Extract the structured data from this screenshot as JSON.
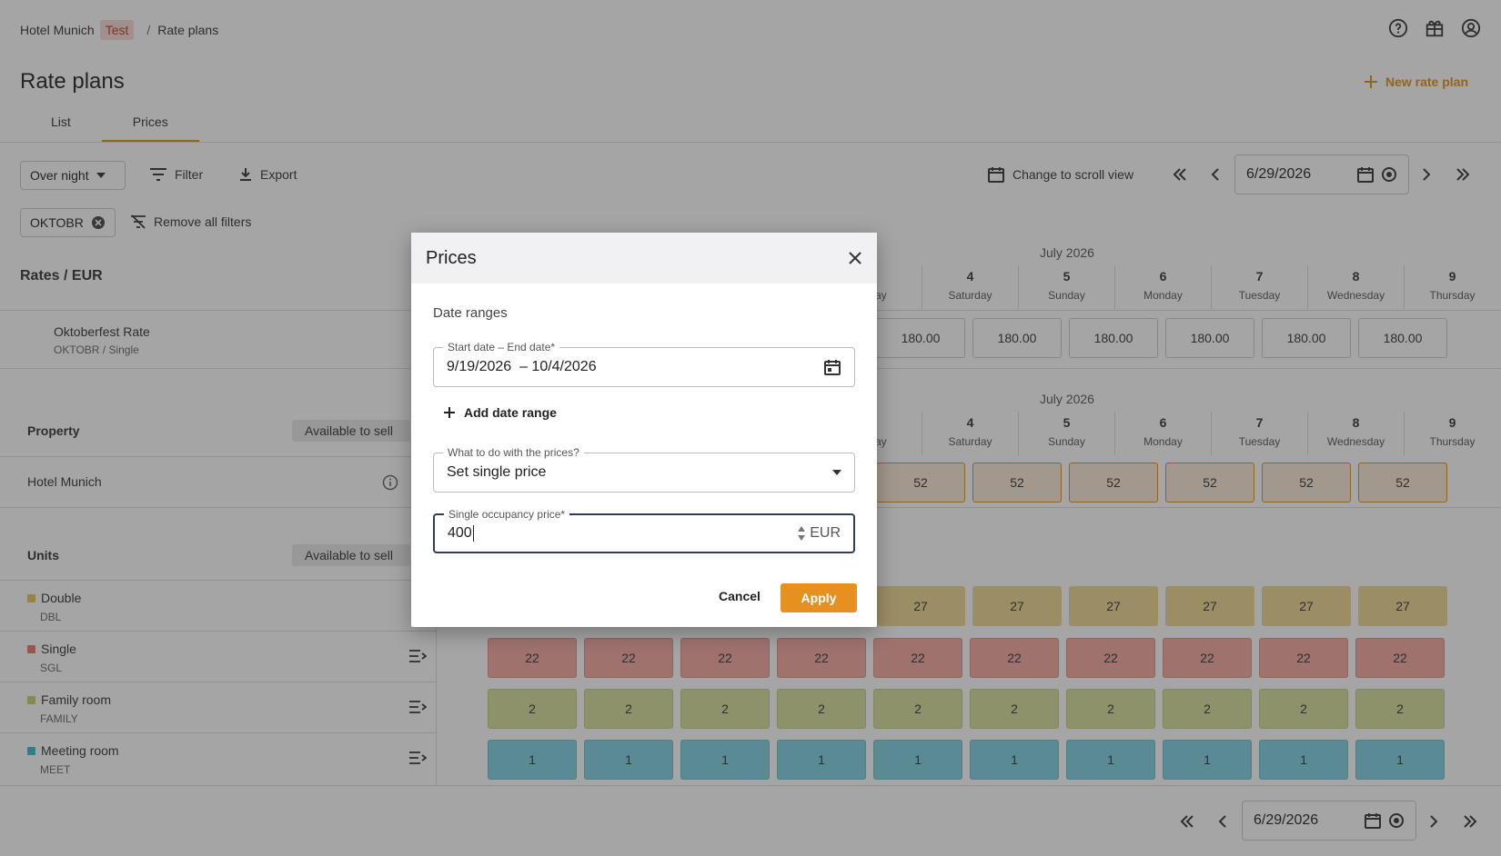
{
  "header": {
    "breadcrumb_hotel": "Hotel Munich",
    "breadcrumb_badge": "Test",
    "breadcrumb_separator": "/",
    "breadcrumb_page": "Rate plans",
    "title": "Rate plans",
    "new_rate_plan": "New rate plan"
  },
  "tabs": [
    {
      "label": "List"
    },
    {
      "label": "Prices"
    }
  ],
  "toolbar": {
    "mode_select": "Over night",
    "filter": "Filter",
    "export": "Export",
    "scroll_view": "Change to scroll view",
    "date": "6/29/2026"
  },
  "filters": {
    "chip": "OKTOBR",
    "remove_all": "Remove all filters"
  },
  "grid": {
    "rates_header": "Rates / EUR",
    "rate_name": "Oktoberfest Rate",
    "rate_code": "OKTOBR / Single",
    "month": "July 2026",
    "partial_day_label": "ay",
    "days": [
      {
        "num": "4",
        "weekday": "Saturday"
      },
      {
        "num": "5",
        "weekday": "Sunday"
      },
      {
        "num": "6",
        "weekday": "Monday"
      },
      {
        "num": "7",
        "weekday": "Tuesday"
      },
      {
        "num": "8",
        "weekday": "Wednesday"
      },
      {
        "num": "9",
        "weekday": "Thursday"
      }
    ],
    "prices": [
      "180.00",
      "180.00",
      "180.00",
      "180.00",
      "180.00",
      "180.00"
    ],
    "property_title": "Property",
    "available_to_sell": "Available to sell",
    "property_name": "Hotel Munich",
    "property_values": [
      "52",
      "52",
      "52",
      "52",
      "52",
      "52"
    ],
    "units_title": "Units",
    "units": [
      {
        "name": "Double",
        "code": "DBL",
        "color": "#e6c55a",
        "values": [
          "27",
          "27",
          "27",
          "27",
          "27",
          "27"
        ]
      },
      {
        "name": "Single",
        "code": "SGL",
        "color": "#e07a6a",
        "values": [
          "22",
          "22",
          "22",
          "22",
          "22",
          "22",
          "22",
          "22",
          "22",
          "22"
        ]
      },
      {
        "name": "Family room",
        "code": "FAMILY",
        "color": "#c9d16e",
        "values": [
          "2",
          "2",
          "2",
          "2",
          "2",
          "2",
          "2",
          "2",
          "2",
          "2"
        ]
      },
      {
        "name": "Meeting room",
        "code": "MEET",
        "color": "#3bb8d3",
        "values": [
          "1",
          "1",
          "1",
          "1",
          "1",
          "1",
          "1",
          "1",
          "1",
          "1"
        ]
      }
    ],
    "bottom_date": "6/29/2026"
  },
  "dialog": {
    "title": "Prices",
    "subtitle": "Date ranges",
    "date_label": "Start date – End date*",
    "date_value": "9/19/2026  – 10/4/2026",
    "add_range": "Add date range",
    "action_label": "What to do with the prices?",
    "action_value": "Set single price",
    "price_label": "Single occupancy price*",
    "price_value": "400",
    "currency": "EUR",
    "cancel": "Cancel",
    "apply": "Apply"
  }
}
